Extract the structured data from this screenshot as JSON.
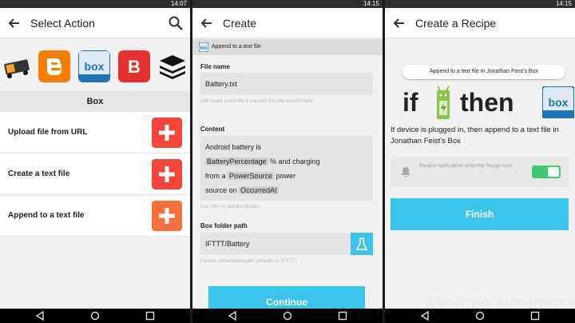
{
  "status": {
    "time_p1": "14:07",
    "time_p2": "14:15",
    "time_p3": "14:15",
    "icons": "✉ ◎ ♥ ▲ ▮"
  },
  "panel1": {
    "title": "Select Action",
    "brands": [
      {
        "name": "box-car-icon",
        "color": "#f5a623"
      },
      {
        "name": "blogger-icon",
        "color": "#f57d00"
      },
      {
        "name": "box-icon",
        "color": "#1f73b7",
        "label": "box"
      },
      {
        "name": "bitly-b-icon",
        "color": "#e53030",
        "label": "B"
      },
      {
        "name": "buffer-icon",
        "color": "#111111"
      }
    ],
    "section_label": "Box",
    "actions": [
      {
        "label": "Upload file from URL"
      },
      {
        "label": "Create a text file"
      },
      {
        "label": "Append to a text file"
      }
    ],
    "action_color": "#f5453a"
  },
  "panel2": {
    "title": "Create",
    "append_bar": "Append to a text file",
    "file_name_label": "File name",
    "file_name_value": "Battery.txt",
    "file_name_hint": "Will create a new file if one with this title doesn't exist",
    "content_label": "Content",
    "content": {
      "line1": "Android battery is",
      "pill1": "BatteryPercentage",
      "after_pill1": " % and charging",
      "line3_prefix": "from a ",
      "pill2": "PowerSource",
      "after_pill2": " power",
      "line4_prefix": "source on ",
      "pill3": "OccurredAt"
    },
    "content_hint": "Use <br> to add line breaks",
    "folder_label": "Box folder path",
    "folder_value": "IFTTT/Battery",
    "folder_hint": "Format: some/folder/path (defaults to 'IFTTT')",
    "continue_label": "Continue",
    "accent": "#3cc3ec"
  },
  "panel3": {
    "title": "Create a Recipe",
    "chip": "Append to a text file in Jonathan Feist's Box",
    "if_word": "if",
    "then_word": "then",
    "description": "If device is plugged in, then append to a text file in Jonathan Feist's Box",
    "notify_text": "Receive notifications when this Recipe runs",
    "notify_on": true,
    "finish_label": "Finish",
    "toggle_color": "#3ecb6e"
  },
  "watermark": "ANDROID AUTHORITY"
}
